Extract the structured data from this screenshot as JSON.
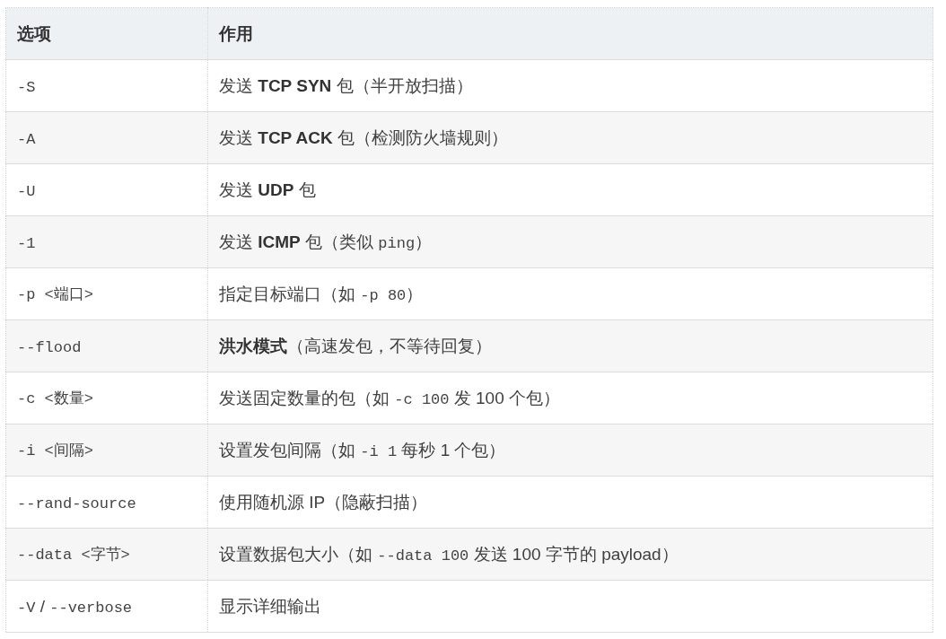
{
  "table": {
    "columns": [
      "选项",
      "作用"
    ],
    "rows": [
      {
        "option": [
          {
            "kind": "code",
            "text": "-S"
          }
        ],
        "effect": [
          {
            "kind": "text",
            "text": "发送 "
          },
          {
            "kind": "bold",
            "text": "TCP SYN"
          },
          {
            "kind": "text",
            "text": " 包（半开放扫描）"
          }
        ]
      },
      {
        "option": [
          {
            "kind": "code",
            "text": "-A"
          }
        ],
        "effect": [
          {
            "kind": "text",
            "text": "发送 "
          },
          {
            "kind": "bold",
            "text": "TCP ACK"
          },
          {
            "kind": "text",
            "text": " 包（检测防火墙规则）"
          }
        ]
      },
      {
        "option": [
          {
            "kind": "code",
            "text": "-U"
          }
        ],
        "effect": [
          {
            "kind": "text",
            "text": "发送 "
          },
          {
            "kind": "bold",
            "text": "UDP"
          },
          {
            "kind": "text",
            "text": " 包"
          }
        ]
      },
      {
        "option": [
          {
            "kind": "code",
            "text": "-1"
          }
        ],
        "effect": [
          {
            "kind": "text",
            "text": "发送 "
          },
          {
            "kind": "bold",
            "text": "ICMP"
          },
          {
            "kind": "text",
            "text": " 包（类似 "
          },
          {
            "kind": "code",
            "text": "ping"
          },
          {
            "kind": "text",
            "text": "）"
          }
        ]
      },
      {
        "option": [
          {
            "kind": "code",
            "text": "-p <端口>"
          }
        ],
        "effect": [
          {
            "kind": "text",
            "text": "指定目标端口（如 "
          },
          {
            "kind": "code",
            "text": "-p 80"
          },
          {
            "kind": "text",
            "text": "）"
          }
        ]
      },
      {
        "option": [
          {
            "kind": "code",
            "text": "--flood"
          }
        ],
        "effect": [
          {
            "kind": "bold",
            "text": "洪水模式"
          },
          {
            "kind": "text",
            "text": "（高速发包，不等待回复）"
          }
        ]
      },
      {
        "option": [
          {
            "kind": "code",
            "text": "-c <数量>"
          }
        ],
        "effect": [
          {
            "kind": "text",
            "text": "发送固定数量的包（如 "
          },
          {
            "kind": "code",
            "text": "-c 100"
          },
          {
            "kind": "text",
            "text": " 发 100 个包）"
          }
        ]
      },
      {
        "option": [
          {
            "kind": "code",
            "text": "-i <间隔>"
          }
        ],
        "effect": [
          {
            "kind": "text",
            "text": "设置发包间隔（如 "
          },
          {
            "kind": "code",
            "text": "-i 1"
          },
          {
            "kind": "text",
            "text": " 每秒 1 个包）"
          }
        ]
      },
      {
        "option": [
          {
            "kind": "code",
            "text": "--rand-source"
          }
        ],
        "effect": [
          {
            "kind": "text",
            "text": "使用随机源 IP（隐蔽扫描）"
          }
        ]
      },
      {
        "option": [
          {
            "kind": "code",
            "text": "--data <字节>"
          }
        ],
        "effect": [
          {
            "kind": "text",
            "text": "设置数据包大小（如 "
          },
          {
            "kind": "code",
            "text": "--data 100"
          },
          {
            "kind": "text",
            "text": " 发送 100 字节的 payload）"
          }
        ]
      },
      {
        "option": [
          {
            "kind": "code",
            "text": "-V"
          },
          {
            "kind": "text",
            "text": " / "
          },
          {
            "kind": "code",
            "text": "--verbose"
          }
        ],
        "effect": [
          {
            "kind": "text",
            "text": "显示详细输出"
          }
        ]
      }
    ]
  }
}
